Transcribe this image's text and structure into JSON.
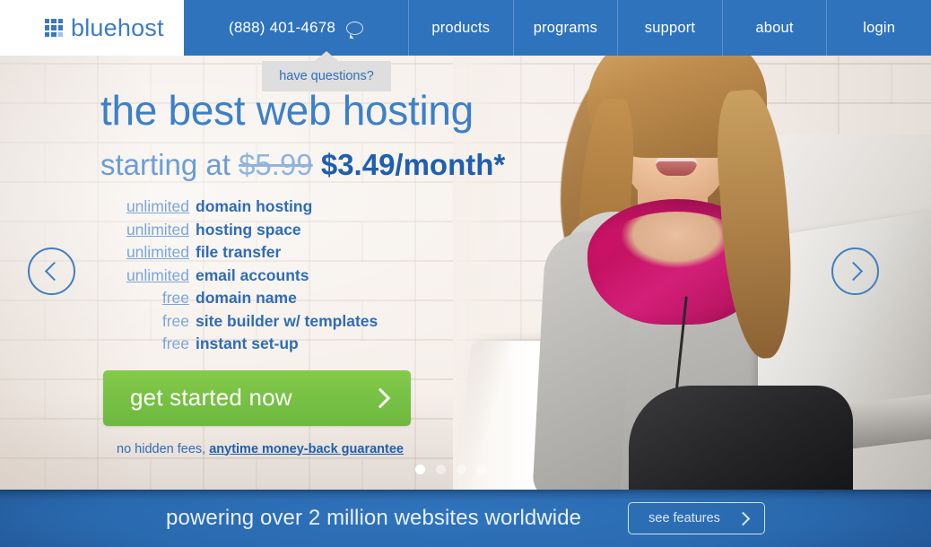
{
  "brand": {
    "name": "bluehost",
    "logo_icon": "grid-squares-icon"
  },
  "topnav": {
    "phone": "(888) 401-4678",
    "chat_icon": "speech-bubble-icon",
    "items": [
      {
        "label": "products"
      },
      {
        "label": "programs"
      },
      {
        "label": "support"
      },
      {
        "label": "about"
      },
      {
        "label": "login"
      }
    ]
  },
  "tooltip": {
    "text": "have questions?"
  },
  "hero": {
    "headline": "the best web hosting",
    "subhead_prefix": "starting at ",
    "old_price": "$5.99",
    "new_price": "$3.49/month*",
    "features": [
      {
        "qualifier": "unlimited",
        "underlined": true,
        "description": "domain hosting"
      },
      {
        "qualifier": "unlimited",
        "underlined": true,
        "description": "hosting space"
      },
      {
        "qualifier": "unlimited",
        "underlined": true,
        "description": "file transfer"
      },
      {
        "qualifier": "unlimited",
        "underlined": true,
        "description": "email accounts"
      },
      {
        "qualifier": "free",
        "underlined": true,
        "description": "domain name"
      },
      {
        "qualifier": "free",
        "underlined": false,
        "description": "site builder w/ templates"
      },
      {
        "qualifier": "free",
        "underlined": false,
        "description": "instant set-up"
      }
    ],
    "cta_label": "get started now",
    "cta_icon": "chevron-right-icon",
    "fineprint_prefix": "no hidden fees, ",
    "fineprint_link": "anytime money-back guarantee"
  },
  "carousel": {
    "prev_icon": "chevron-left-icon",
    "next_icon": "chevron-right-icon",
    "slides": 4,
    "active_slide": 1
  },
  "bottombar": {
    "text": "powering over 2 million websites worldwide",
    "button_label": "see features",
    "button_icon": "chevron-right-icon"
  },
  "colors": {
    "nav_blue": "#2f73bd",
    "brand_blue": "#3a7cc4",
    "headline_blue": "#3c80c8",
    "price_blue": "#1f5fae",
    "cta_green": "#76c044",
    "tooltip_gray": "#dedede",
    "wall_cream": "#f6efe9",
    "scarf_pink": "#d41f78"
  }
}
